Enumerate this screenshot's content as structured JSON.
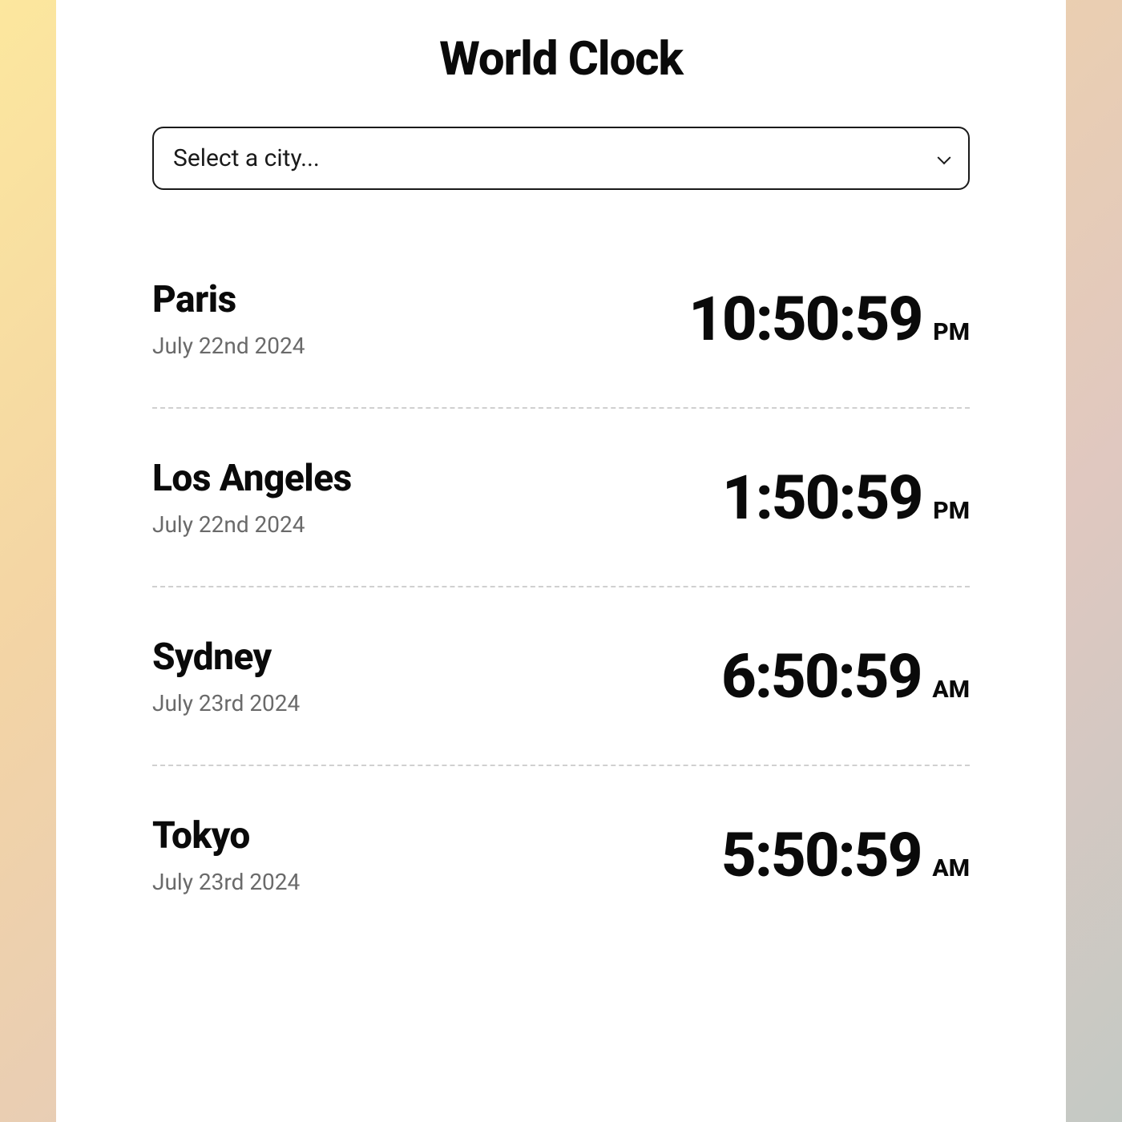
{
  "title": "World Clock",
  "select": {
    "placeholder": "Select a city..."
  },
  "clocks": [
    {
      "city": "Paris",
      "date": "July 22nd 2024",
      "time": "10:50:59",
      "period": "PM"
    },
    {
      "city": "Los Angeles",
      "date": "July 22nd 2024",
      "time": "1:50:59",
      "period": "PM"
    },
    {
      "city": "Sydney",
      "date": "July 23rd 2024",
      "time": "6:50:59",
      "period": "AM"
    },
    {
      "city": "Tokyo",
      "date": "July 23rd 2024",
      "time": "5:50:59",
      "period": "AM"
    }
  ]
}
